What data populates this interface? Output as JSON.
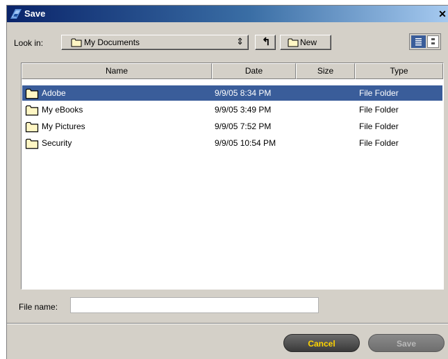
{
  "window": {
    "title": "Save",
    "close_glyph": "✕"
  },
  "toolbar": {
    "look_in_label": "Look in:",
    "look_in_value": "My Documents",
    "new_label": "New",
    "up_glyph": "↰"
  },
  "columns": [
    "Name",
    "Date",
    "Size",
    "Type"
  ],
  "rows": [
    {
      "name": "Adobe",
      "date": "9/9/05 8:34 PM",
      "size": "",
      "type": "File Folder",
      "selected": true
    },
    {
      "name": "My eBooks",
      "date": "9/9/05 3:49 PM",
      "size": "",
      "type": "File Folder",
      "selected": false
    },
    {
      "name": "My Pictures",
      "date": "9/9/05 7:52 PM",
      "size": "",
      "type": "File Folder",
      "selected": false
    },
    {
      "name": "Security",
      "date": "9/9/05 10:54 PM",
      "size": "",
      "type": "File Folder",
      "selected": false
    }
  ],
  "file_name": {
    "label": "File name:",
    "value": ""
  },
  "buttons": {
    "cancel": "Cancel",
    "save": "Save"
  },
  "colors": {
    "selection": "#3a5d9a",
    "cancel_text": "#ffd400",
    "title_gradient_start": "#0a246a"
  },
  "icons": [
    "app-logo-icon",
    "close-icon",
    "folder-icon",
    "up-folder-icon",
    "list-view-icon",
    "details-view-icon"
  ]
}
